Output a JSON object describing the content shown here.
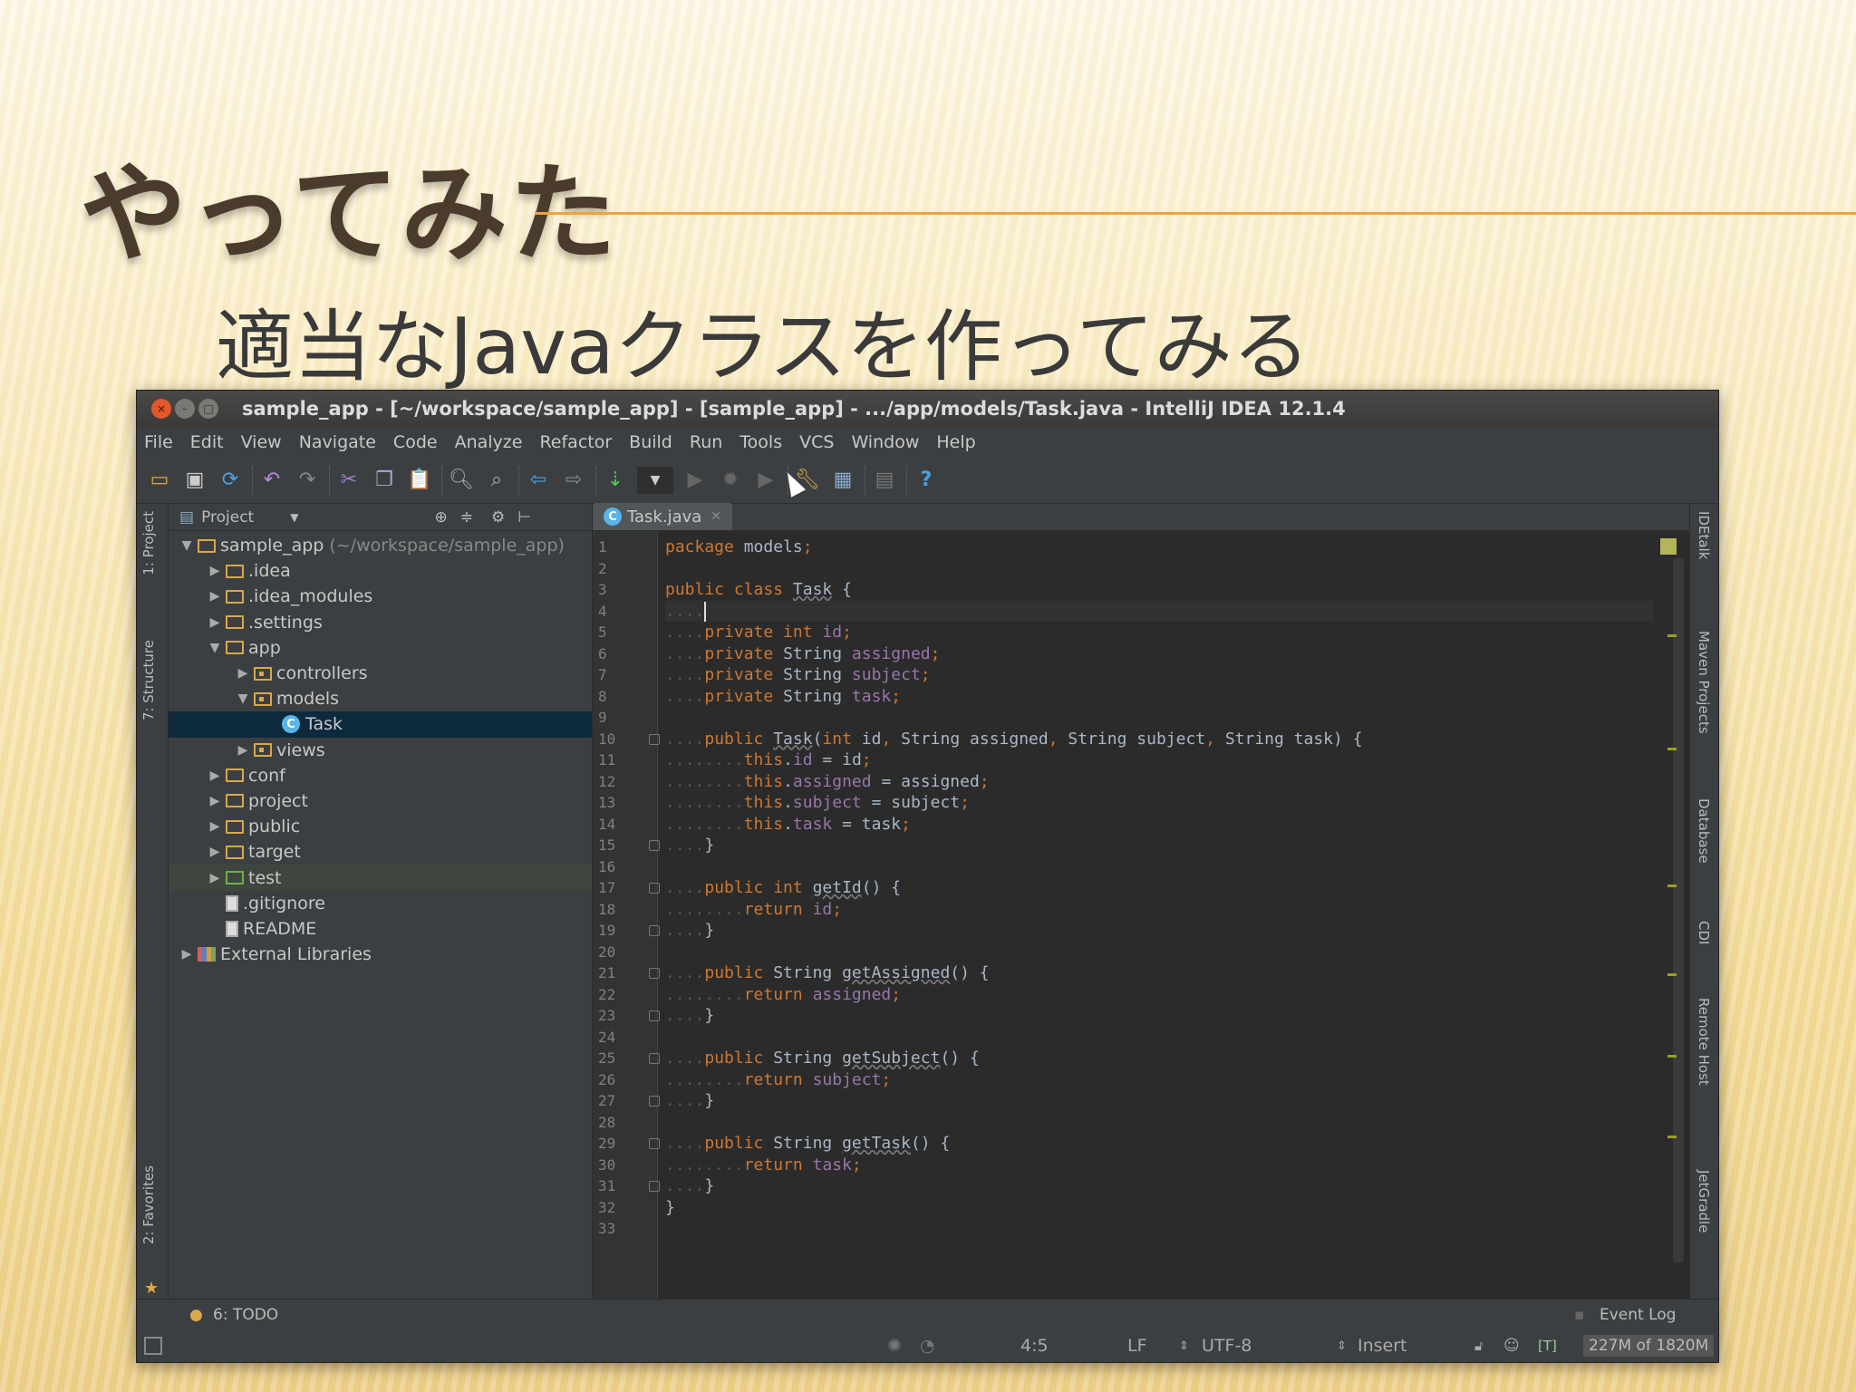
{
  "slide": {
    "title": "やってみた",
    "subtitle": "適当なJavaクラスを作ってみる"
  },
  "window": {
    "title": "sample_app - [~/workspace/sample_app] - [sample_app] - .../app/models/Task.java - IntelliJ IDEA 12.1.4"
  },
  "menu": [
    "File",
    "Edit",
    "View",
    "Navigate",
    "Code",
    "Analyze",
    "Refactor",
    "Build",
    "Run",
    "Tools",
    "VCS",
    "Window",
    "Help"
  ],
  "toolbar_icons": [
    "open-folder-icon",
    "save-icon",
    "sync-icon",
    "undo-icon",
    "redo-icon",
    "cut-icon",
    "copy-icon",
    "paste-icon",
    "find-icon",
    "replace-icon",
    "back-icon",
    "forward-icon",
    "make-project-icon",
    "run-config-dropdown",
    "run-icon",
    "debug-icon",
    "run-coverage-icon",
    "settings-icon",
    "project-structure-icon",
    "sdk-icon",
    "help-icon"
  ],
  "left_tabs": [
    "1: Project",
    "7: Structure",
    "2: Favorites"
  ],
  "right_tabs": [
    "IDEtalk",
    "Maven Projects",
    "Database",
    "CDI",
    "Remote Host",
    "JetGradle"
  ],
  "project_panel": {
    "label": "Project",
    "tree": [
      {
        "label": "sample_app",
        "hint": "(~/workspace/sample_app)",
        "depth": 0,
        "arrow": "▼",
        "icon": "module"
      },
      {
        "label": ".idea",
        "depth": 1,
        "arrow": "▶",
        "icon": "folder"
      },
      {
        "label": ".idea_modules",
        "depth": 1,
        "arrow": "▶",
        "icon": "folder"
      },
      {
        "label": ".settings",
        "depth": 1,
        "arrow": "▶",
        "icon": "folder"
      },
      {
        "label": "app",
        "depth": 1,
        "arrow": "▼",
        "icon": "folder"
      },
      {
        "label": "controllers",
        "depth": 2,
        "arrow": "▶",
        "icon": "package"
      },
      {
        "label": "models",
        "depth": 2,
        "arrow": "▼",
        "icon": "package"
      },
      {
        "label": "Task",
        "depth": 3,
        "arrow": "",
        "icon": "class",
        "selected": true
      },
      {
        "label": "views",
        "depth": 2,
        "arrow": "▶",
        "icon": "package"
      },
      {
        "label": "conf",
        "depth": 1,
        "arrow": "▶",
        "icon": "folder"
      },
      {
        "label": "project",
        "depth": 1,
        "arrow": "▶",
        "icon": "folder"
      },
      {
        "label": "public",
        "depth": 1,
        "arrow": "▶",
        "icon": "folder"
      },
      {
        "label": "target",
        "depth": 1,
        "arrow": "▶",
        "icon": "folder"
      },
      {
        "label": "test",
        "depth": 1,
        "arrow": "▶",
        "icon": "test-folder",
        "test": true
      },
      {
        "label": ".gitignore",
        "depth": 1,
        "arrow": "",
        "icon": "file"
      },
      {
        "label": "README",
        "depth": 1,
        "arrow": "",
        "icon": "file"
      },
      {
        "label": "External Libraries",
        "depth": 0,
        "arrow": "▶",
        "icon": "library"
      }
    ]
  },
  "editor": {
    "tab": "Task.java",
    "tab_icon": "C",
    "lines": [
      [
        [
          "package",
          "k"
        ],
        [
          " models",
          ""
        ],
        [
          ";",
          "k"
        ]
      ],
      [],
      [
        [
          "public class ",
          "k"
        ],
        [
          "Task",
          "u"
        ],
        [
          " {",
          ""
        ]
      ],
      [
        [
          "....",
          "d"
        ],
        [
          "|",
          "caret"
        ]
      ],
      [
        [
          "....",
          "d"
        ],
        [
          "private int ",
          "k"
        ],
        [
          "id",
          "f"
        ],
        [
          ";",
          "k"
        ]
      ],
      [
        [
          "....",
          "d"
        ],
        [
          "private ",
          "k"
        ],
        [
          "String ",
          ""
        ],
        [
          "assigned",
          "f"
        ],
        [
          ";",
          "k"
        ]
      ],
      [
        [
          "....",
          "d"
        ],
        [
          "private ",
          "k"
        ],
        [
          "String ",
          ""
        ],
        [
          "subject",
          "f"
        ],
        [
          ";",
          "k"
        ]
      ],
      [
        [
          "....",
          "d"
        ],
        [
          "private ",
          "k"
        ],
        [
          "String ",
          ""
        ],
        [
          "task",
          "f"
        ],
        [
          ";",
          "k"
        ]
      ],
      [],
      [
        [
          "....",
          "d"
        ],
        [
          "public ",
          "k"
        ],
        [
          "Task",
          "u"
        ],
        [
          "(",
          ""
        ],
        [
          "int ",
          "k"
        ],
        [
          "id",
          ""
        ],
        [
          ", ",
          "k"
        ],
        [
          "String assigned",
          ""
        ],
        [
          ", ",
          "k"
        ],
        [
          "String subject",
          ""
        ],
        [
          ", ",
          "k"
        ],
        [
          "String task) {",
          ""
        ]
      ],
      [
        [
          "........",
          "d"
        ],
        [
          "this",
          "k"
        ],
        [
          ".",
          ""
        ],
        [
          "id",
          "f"
        ],
        [
          " = id",
          ""
        ],
        [
          ";",
          "k"
        ]
      ],
      [
        [
          "........",
          "d"
        ],
        [
          "this",
          "k"
        ],
        [
          ".",
          ""
        ],
        [
          "assigned",
          "f"
        ],
        [
          " = assigned",
          ""
        ],
        [
          ";",
          "k"
        ]
      ],
      [
        [
          "........",
          "d"
        ],
        [
          "this",
          "k"
        ],
        [
          ".",
          ""
        ],
        [
          "subject",
          "f"
        ],
        [
          " = subject",
          ""
        ],
        [
          ";",
          "k"
        ]
      ],
      [
        [
          "........",
          "d"
        ],
        [
          "this",
          "k"
        ],
        [
          ".",
          ""
        ],
        [
          "task",
          "f"
        ],
        [
          " = task",
          ""
        ],
        [
          ";",
          "k"
        ]
      ],
      [
        [
          "....",
          "d"
        ],
        [
          "}",
          ""
        ]
      ],
      [],
      [
        [
          "....",
          "d"
        ],
        [
          "public int ",
          "k"
        ],
        [
          "getId",
          "u"
        ],
        [
          "() {",
          ""
        ]
      ],
      [
        [
          "........",
          "d"
        ],
        [
          "return ",
          "k"
        ],
        [
          "id",
          "f"
        ],
        [
          ";",
          "k"
        ]
      ],
      [
        [
          "....",
          "d"
        ],
        [
          "}",
          ""
        ]
      ],
      [],
      [
        [
          "....",
          "d"
        ],
        [
          "public ",
          "k"
        ],
        [
          "String ",
          ""
        ],
        [
          "getAssigned",
          "u"
        ],
        [
          "() {",
          ""
        ]
      ],
      [
        [
          "........",
          "d"
        ],
        [
          "return ",
          "k"
        ],
        [
          "assigned",
          "f"
        ],
        [
          ";",
          "k"
        ]
      ],
      [
        [
          "....",
          "d"
        ],
        [
          "}",
          ""
        ]
      ],
      [],
      [
        [
          "....",
          "d"
        ],
        [
          "public ",
          "k"
        ],
        [
          "String ",
          ""
        ],
        [
          "getSubject",
          "u"
        ],
        [
          "() {",
          ""
        ]
      ],
      [
        [
          "........",
          "d"
        ],
        [
          "return ",
          "k"
        ],
        [
          "subject",
          "f"
        ],
        [
          ";",
          "k"
        ]
      ],
      [
        [
          "....",
          "d"
        ],
        [
          "}",
          ""
        ]
      ],
      [],
      [
        [
          "....",
          "d"
        ],
        [
          "public ",
          "k"
        ],
        [
          "String ",
          ""
        ],
        [
          "getTask",
          "u"
        ],
        [
          "() {",
          ""
        ]
      ],
      [
        [
          "........",
          "d"
        ],
        [
          "return ",
          "k"
        ],
        [
          "task",
          "f"
        ],
        [
          ";",
          "k"
        ]
      ],
      [
        [
          "....",
          "d"
        ],
        [
          "}",
          ""
        ]
      ],
      [
        [
          "}",
          ""
        ]
      ],
      []
    ],
    "current_line": 4,
    "fold_lines": [
      10,
      15,
      17,
      19,
      21,
      23,
      25,
      27,
      29,
      31
    ]
  },
  "bottom": {
    "todo": "6: TODO",
    "event_log": "Event Log"
  },
  "status": {
    "position": "4:5",
    "line_sep": "LF",
    "encoding": "UTF-8",
    "mode": "Insert",
    "indicator": "[T]",
    "memory": "227M of 1820M"
  }
}
